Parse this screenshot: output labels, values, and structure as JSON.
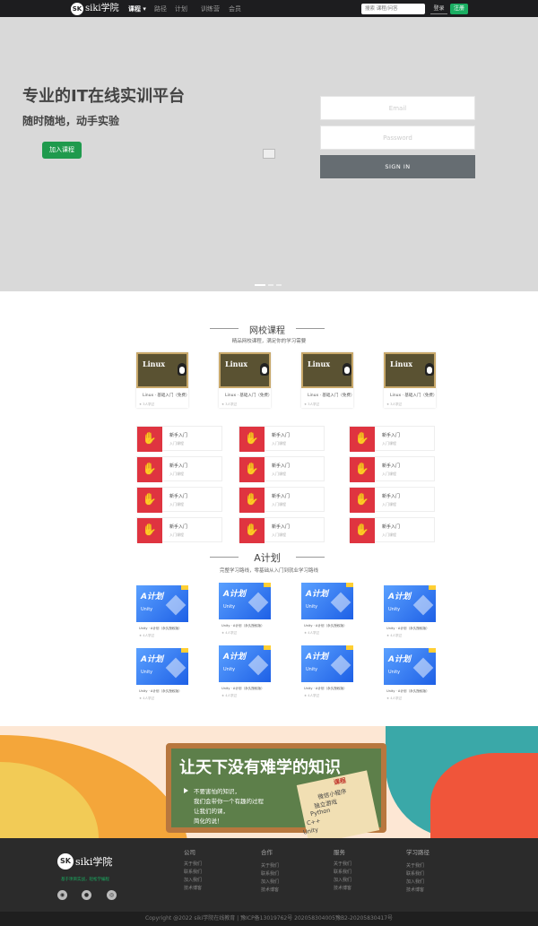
{
  "nav": {
    "logo_badge": "SK",
    "logo_text": "siki学院",
    "items": [
      "课程",
      "路径",
      "计划",
      "训练营",
      "会员"
    ],
    "search_placeholder": "搜索 课程/问答",
    "login": "登录",
    "register": "注册"
  },
  "hero": {
    "title": "专业的IT在线实训平台",
    "subtitle": "随时随地，动手实验",
    "join_button": "加入课程",
    "email_placeholder": "Email",
    "password_placeholder": "Password",
    "signin_button": "SIGN IN"
  },
  "school": {
    "title": "网校课程",
    "subtitle": "精品网校课程，满足你的学习需要",
    "card_brand": "Linux",
    "cards": [
      {
        "caption": "Linux · 基础入门（免费）",
        "meta": "★ 3人学过"
      },
      {
        "caption": "Linux · 基础入门（免费）",
        "meta": "★ 3人学过"
      },
      {
        "caption": "Linux · 基础入门（免费）",
        "meta": "★ 3人学过"
      },
      {
        "caption": "Linux · 基础入门（免费）",
        "meta": "★ 3人学过"
      }
    ],
    "items": [
      {
        "title": "新手入门",
        "sub": "入门课程"
      },
      {
        "title": "新手入门",
        "sub": "入门课程"
      },
      {
        "title": "新手入门",
        "sub": "入门课程"
      },
      {
        "title": "新手入门",
        "sub": "入门课程"
      },
      {
        "title": "新手入门",
        "sub": "入门课程"
      },
      {
        "title": "新手入门",
        "sub": "入门课程"
      },
      {
        "title": "新手入门",
        "sub": "入门课程"
      },
      {
        "title": "新手入门",
        "sub": "入门课程"
      },
      {
        "title": "新手入门",
        "sub": "入门课程"
      },
      {
        "title": "新手入门",
        "sub": "入门课程"
      },
      {
        "title": "新手入门",
        "sub": "入门课程"
      },
      {
        "title": "新手入门",
        "sub": "入门课程"
      }
    ]
  },
  "plan": {
    "title": "A计划",
    "subtitle": "完整学习路线，零基础从入门到就业学习路线",
    "thumb_title": "A计划",
    "thumb_sub": "Unity",
    "cards": [
      {
        "caption": "Unity · A计划（永久授权版）",
        "meta": "★ 4人学过"
      },
      {
        "caption": "Unity · A计划（永久授权版）",
        "meta": "★ 4人学过"
      },
      {
        "caption": "Unity · A计划（永久授权版）",
        "meta": "★ 4人学过"
      },
      {
        "caption": "Unity · A计划（永久授权版）",
        "meta": "★ 4人学过"
      },
      {
        "caption": "Unity · A计划（永久授权版）",
        "meta": "★ 4人学过"
      },
      {
        "caption": "Unity · A计划（永久授权版）",
        "meta": "★ 4人学过"
      },
      {
        "caption": "Unity · A计划（永久授权版）",
        "meta": "★ 4人学过"
      },
      {
        "caption": "Unity · A计划（永久授权版）",
        "meta": "★ 4人学过"
      }
    ]
  },
  "banner": {
    "title": "让天下没有难学的知识",
    "lines": [
      "不要害怕的知识，",
      "我们会带你一个有趣的过程",
      "让我们的课，",
      "简化的说！"
    ],
    "paper_top": "课程",
    "paper_lines": [
      "微信小程序",
      "独立游戏",
      "Python",
      "C++",
      "Unity"
    ]
  },
  "footer": {
    "logo_badge": "SK",
    "logo_text": "siki学院",
    "slogan": "基于项目实战，轻松学编程",
    "social_icons": [
      "wechat-icon",
      "qq-icon",
      "weibo-icon"
    ],
    "columns": [
      {
        "head": "公司",
        "links": [
          "关于我们",
          "联系我们",
          "加入我们",
          "技术博客"
        ]
      },
      {
        "head": "合作",
        "links": [
          "关于我们",
          "联系我们",
          "加入我们",
          "技术博客"
        ]
      },
      {
        "head": "服务",
        "links": [
          "关于我们",
          "联系我们",
          "加入我们",
          "技术博客"
        ]
      },
      {
        "head": "学习路径",
        "links": [
          "关于我们",
          "联系我们",
          "加入我们",
          "技术博客"
        ]
      }
    ],
    "copyright": "Copyright @2022 siki学院在线教育 | 豫ICP备13019762号 202058304005豫B2-20205830417号"
  },
  "colors": {
    "accent": "#1aae62",
    "nav_bg": "#1d1d1f",
    "footer_bg": "#2b2b2b",
    "item_red": "#df3440"
  }
}
